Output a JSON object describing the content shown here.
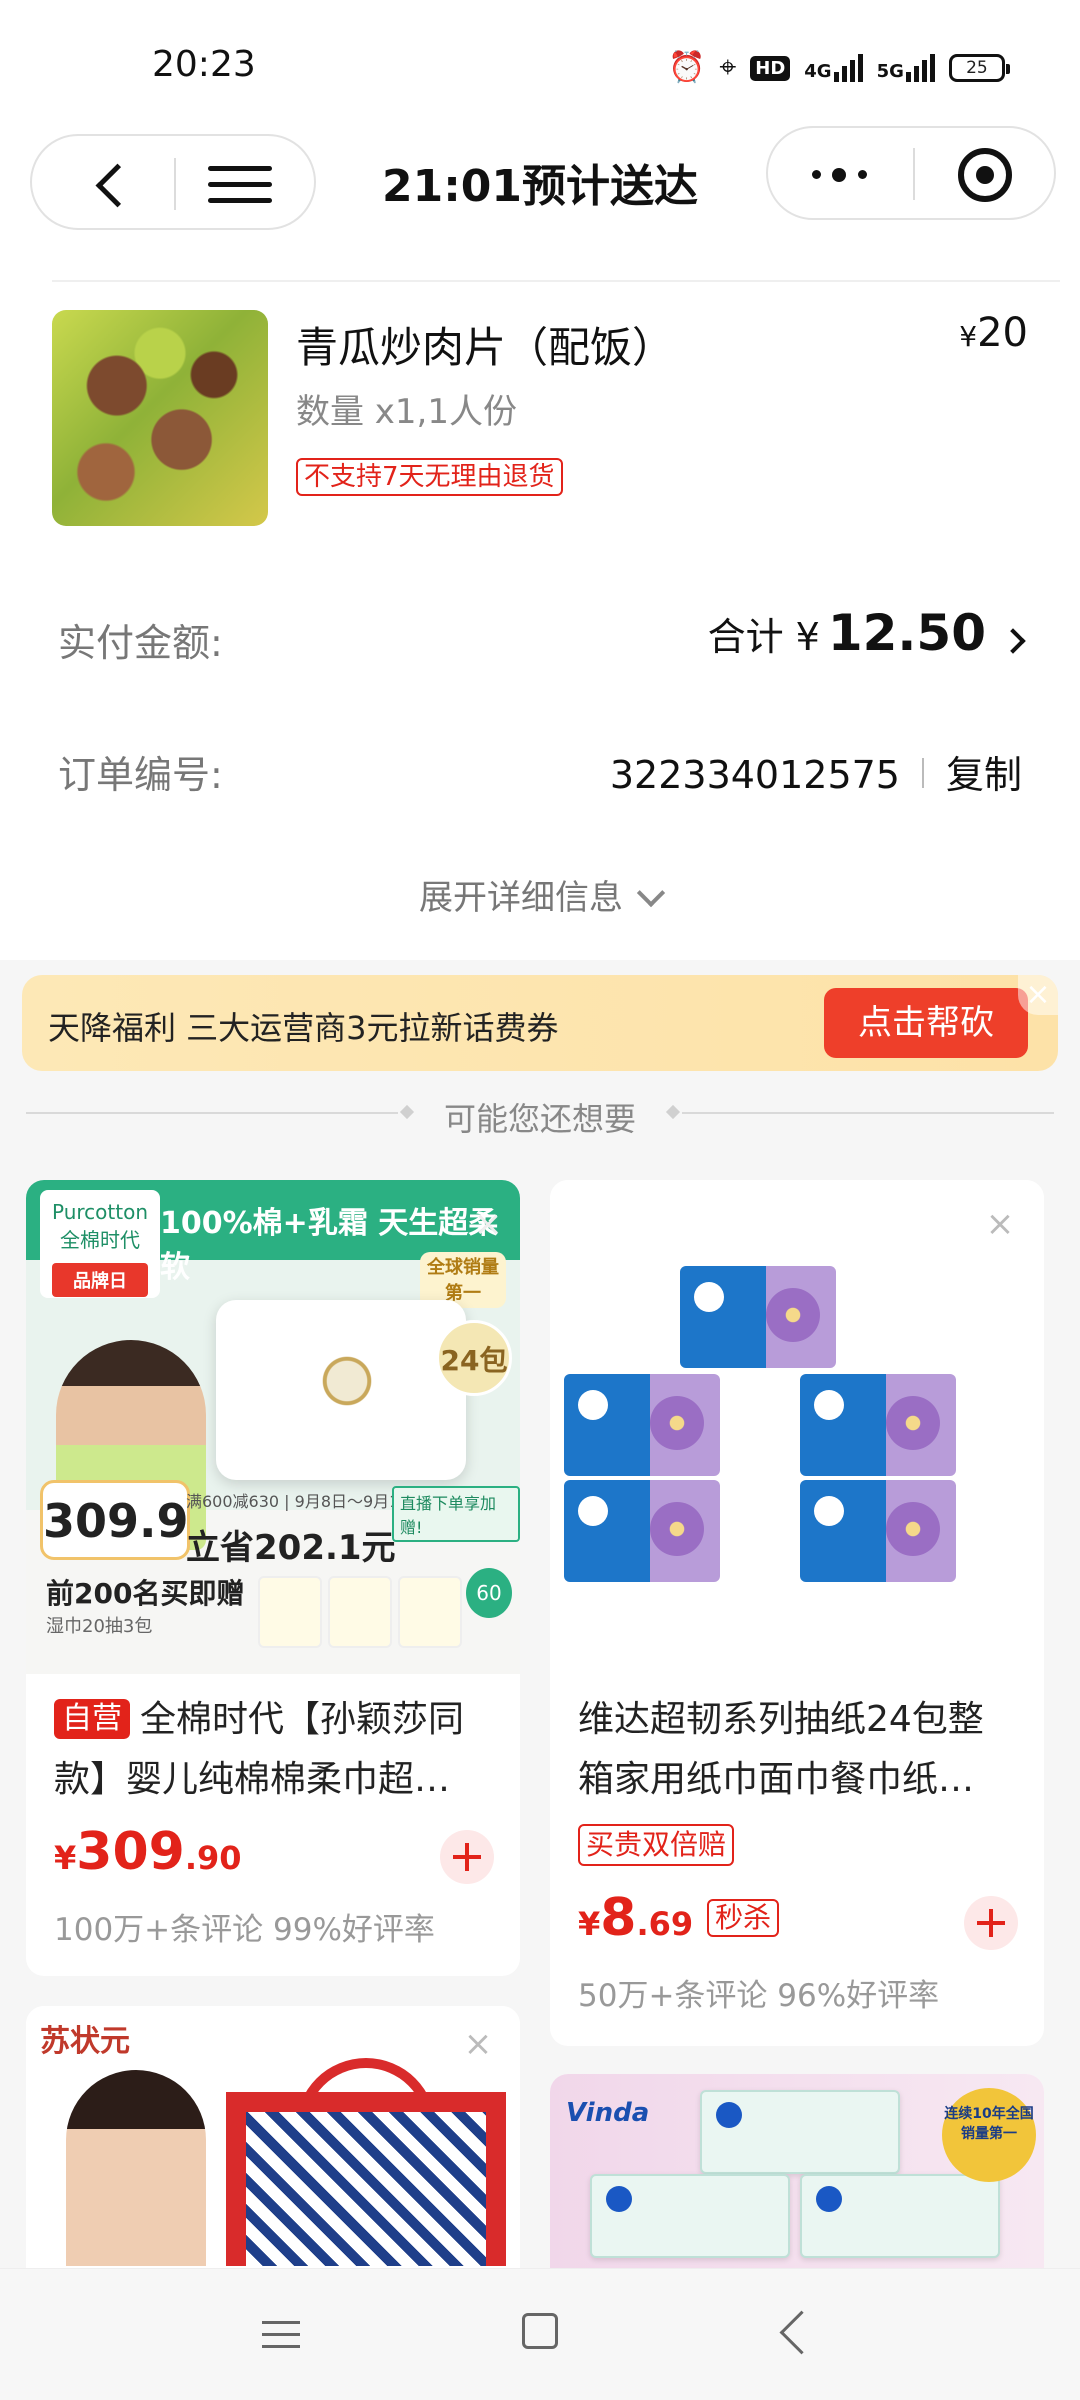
{
  "status_bar": {
    "time": "20:23",
    "battery": "25",
    "net1": "4G",
    "net2": "5G"
  },
  "header": {
    "title": "21:01预计送达"
  },
  "order_item": {
    "name": "青瓜炒肉片（配饭）",
    "qty": "数量 x1,1人份",
    "tag": "不支持7天无理由退货",
    "price_symbol": "¥",
    "price": "20"
  },
  "payment": {
    "label": "实付金额:",
    "total_prefix": "合计 ¥",
    "total": "12.50"
  },
  "order_no": {
    "label": "订单编号:",
    "value": "322334012575",
    "copy": "复制"
  },
  "expand": {
    "label": "展开详细信息"
  },
  "banner": {
    "text": "天降福利 三大运营商3元拉新话费券",
    "button": "点击帮砍",
    "close": "×"
  },
  "recommend": {
    "title": "可能您还想要"
  },
  "products": [
    {
      "tag": "自营",
      "title": "全棉时代【孙颖莎同款】婴儿纯棉棉柔巾超…",
      "price_symbol": "¥",
      "price_int": "309",
      "price_dec": ".90",
      "meta": "100万+条评论  99%好评率",
      "image": {
        "brand": "Purcotton",
        "brand_cn": "全棉时代",
        "store_tag": "品牌日",
        "slogan": "100%棉+乳霜 天生超柔软",
        "badge": "24包",
        "global": "全球销量第一",
        "hand_price": "309.9",
        "save_note": "满600减630 | 9月8日～9月14日",
        "save": "立省202.1元",
        "live": "直播下单享加赠!",
        "first": "前200名买即赠",
        "first_sub": "湿巾20抽3包",
        "gift": "60"
      }
    },
    {
      "tag": "",
      "title": "维达超韧系列抽纸24包整箱家用纸巾面巾餐巾纸…",
      "double": "买贵双倍赔",
      "price_symbol": "¥",
      "price_int": "8",
      "price_dec": ".69",
      "flash": "秒杀",
      "meta": "50万+条评论  96%好评率"
    },
    {
      "image": {
        "brand": "苏状元"
      }
    },
    {
      "image": {
        "brand": "Vinda",
        "medal": "连续10年全国销量第一"
      }
    }
  ]
}
